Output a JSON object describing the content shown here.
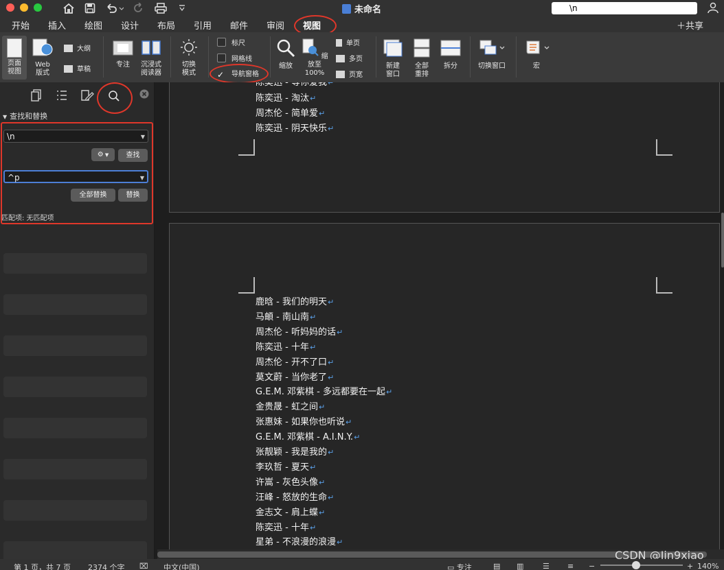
{
  "titlebar": {
    "document_title": "未命名",
    "search_value": "\\n"
  },
  "tabs": [
    "开始",
    "插入",
    "绘图",
    "设计",
    "布局",
    "引用",
    "邮件",
    "审阅",
    "视图"
  ],
  "active_tab": "视图",
  "share_label": "共享",
  "ribbon": {
    "page_view": "页面\n视图",
    "web_view": "Web\n版式",
    "outline": "大纲",
    "draft": "草稿",
    "focus": "专注",
    "immersive_reader": "沉浸式\n阅读器",
    "toggle_mode": "切换\n模式",
    "ruler": "标尺",
    "gridlines": "网格线",
    "nav_pane": "导航窗格",
    "nav_pane_checked": true,
    "zoom": "缩放",
    "zoom_100": "缩放至\n100%",
    "single_page": "单页",
    "multi_page": "多页",
    "page_width": "页宽",
    "new_window": "新建\n窗口",
    "arrange_all": "全部\n重排",
    "split": "拆分",
    "switch_window": "切换窗口",
    "macro": "宏"
  },
  "nav_pane": {
    "section_title": "查找和替换",
    "find_value": "\\n",
    "find_button": "查找",
    "replace_value": "^p",
    "replace_all_button": "全部替换",
    "replace_button": "替换",
    "match_status": "匹配项: 无匹配项"
  },
  "document": {
    "page1_lines": [
      "陈奕迅 - 等你爱我",
      "陈奕迅 - 淘汰",
      "周杰伦 - 简单爱",
      "陈奕迅 - 阴天快乐"
    ],
    "page2_lines": [
      "鹿晗 - 我们的明天",
      "马頔 - 南山南",
      "周杰伦 - 听妈妈的话",
      "陈奕迅 - 十年",
      "周杰伦 - 开不了口",
      "莫文蔚 - 当你老了",
      "G.E.M. 邓紫棋 - 多远都要在一起",
      "金贵晟 - 虹之间",
      "张惠妹 - 如果你也听说",
      "G.E.M. 邓紫棋 - A.I.N.Y.",
      "张靓颖 - 我是我的",
      "李玖哲 - 夏天",
      "许嵩 - 灰色头像",
      "汪峰 - 怒放的生命",
      "金志文 - 肩上蝶",
      "陈奕迅 - 十年",
      "星弟 - 不浪漫的浪漫"
    ],
    "paragraph_mark": "↵"
  },
  "statusbar": {
    "page": "第 1 页，共 7 页",
    "words": "2374 个字",
    "language": "中文(中国)",
    "focus": "专注",
    "zoom": "140%"
  },
  "watermark": "CSDN @Jin9xiao",
  "annotation_color": "#e0372a"
}
